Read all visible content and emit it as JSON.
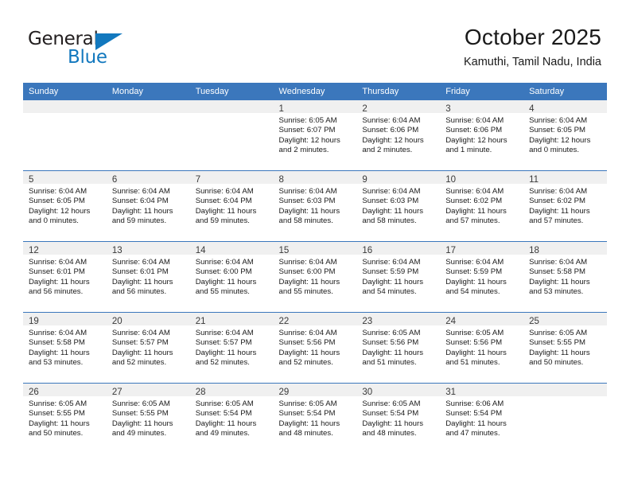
{
  "brand": {
    "name_top": "General",
    "name_bottom": "Blue",
    "accent_color": "#1278be",
    "triangle_icon": "triangle-icon"
  },
  "header": {
    "title": "October 2025",
    "location": "Kamuthi, Tamil Nadu, India"
  },
  "calendar": {
    "header_bg": "#3b77bc",
    "header_text_color": "#ffffff",
    "daynum_bg": "#f0f0f0",
    "weekday_headers": [
      "Sunday",
      "Monday",
      "Tuesday",
      "Wednesday",
      "Thursday",
      "Friday",
      "Saturday"
    ],
    "weeks": [
      [
        {
          "day": "",
          "sunrise": "",
          "sunset": "",
          "daylight1": "",
          "daylight2": ""
        },
        {
          "day": "",
          "sunrise": "",
          "sunset": "",
          "daylight1": "",
          "daylight2": ""
        },
        {
          "day": "",
          "sunrise": "",
          "sunset": "",
          "daylight1": "",
          "daylight2": ""
        },
        {
          "day": "1",
          "sunrise": "Sunrise: 6:05 AM",
          "sunset": "Sunset: 6:07 PM",
          "daylight1": "Daylight: 12 hours",
          "daylight2": "and 2 minutes."
        },
        {
          "day": "2",
          "sunrise": "Sunrise: 6:04 AM",
          "sunset": "Sunset: 6:06 PM",
          "daylight1": "Daylight: 12 hours",
          "daylight2": "and 2 minutes."
        },
        {
          "day": "3",
          "sunrise": "Sunrise: 6:04 AM",
          "sunset": "Sunset: 6:06 PM",
          "daylight1": "Daylight: 12 hours",
          "daylight2": "and 1 minute."
        },
        {
          "day": "4",
          "sunrise": "Sunrise: 6:04 AM",
          "sunset": "Sunset: 6:05 PM",
          "daylight1": "Daylight: 12 hours",
          "daylight2": "and 0 minutes."
        }
      ],
      [
        {
          "day": "5",
          "sunrise": "Sunrise: 6:04 AM",
          "sunset": "Sunset: 6:05 PM",
          "daylight1": "Daylight: 12 hours",
          "daylight2": "and 0 minutes."
        },
        {
          "day": "6",
          "sunrise": "Sunrise: 6:04 AM",
          "sunset": "Sunset: 6:04 PM",
          "daylight1": "Daylight: 11 hours",
          "daylight2": "and 59 minutes."
        },
        {
          "day": "7",
          "sunrise": "Sunrise: 6:04 AM",
          "sunset": "Sunset: 6:04 PM",
          "daylight1": "Daylight: 11 hours",
          "daylight2": "and 59 minutes."
        },
        {
          "day": "8",
          "sunrise": "Sunrise: 6:04 AM",
          "sunset": "Sunset: 6:03 PM",
          "daylight1": "Daylight: 11 hours",
          "daylight2": "and 58 minutes."
        },
        {
          "day": "9",
          "sunrise": "Sunrise: 6:04 AM",
          "sunset": "Sunset: 6:03 PM",
          "daylight1": "Daylight: 11 hours",
          "daylight2": "and 58 minutes."
        },
        {
          "day": "10",
          "sunrise": "Sunrise: 6:04 AM",
          "sunset": "Sunset: 6:02 PM",
          "daylight1": "Daylight: 11 hours",
          "daylight2": "and 57 minutes."
        },
        {
          "day": "11",
          "sunrise": "Sunrise: 6:04 AM",
          "sunset": "Sunset: 6:02 PM",
          "daylight1": "Daylight: 11 hours",
          "daylight2": "and 57 minutes."
        }
      ],
      [
        {
          "day": "12",
          "sunrise": "Sunrise: 6:04 AM",
          "sunset": "Sunset: 6:01 PM",
          "daylight1": "Daylight: 11 hours",
          "daylight2": "and 56 minutes."
        },
        {
          "day": "13",
          "sunrise": "Sunrise: 6:04 AM",
          "sunset": "Sunset: 6:01 PM",
          "daylight1": "Daylight: 11 hours",
          "daylight2": "and 56 minutes."
        },
        {
          "day": "14",
          "sunrise": "Sunrise: 6:04 AM",
          "sunset": "Sunset: 6:00 PM",
          "daylight1": "Daylight: 11 hours",
          "daylight2": "and 55 minutes."
        },
        {
          "day": "15",
          "sunrise": "Sunrise: 6:04 AM",
          "sunset": "Sunset: 6:00 PM",
          "daylight1": "Daylight: 11 hours",
          "daylight2": "and 55 minutes."
        },
        {
          "day": "16",
          "sunrise": "Sunrise: 6:04 AM",
          "sunset": "Sunset: 5:59 PM",
          "daylight1": "Daylight: 11 hours",
          "daylight2": "and 54 minutes."
        },
        {
          "day": "17",
          "sunrise": "Sunrise: 6:04 AM",
          "sunset": "Sunset: 5:59 PM",
          "daylight1": "Daylight: 11 hours",
          "daylight2": "and 54 minutes."
        },
        {
          "day": "18",
          "sunrise": "Sunrise: 6:04 AM",
          "sunset": "Sunset: 5:58 PM",
          "daylight1": "Daylight: 11 hours",
          "daylight2": "and 53 minutes."
        }
      ],
      [
        {
          "day": "19",
          "sunrise": "Sunrise: 6:04 AM",
          "sunset": "Sunset: 5:58 PM",
          "daylight1": "Daylight: 11 hours",
          "daylight2": "and 53 minutes."
        },
        {
          "day": "20",
          "sunrise": "Sunrise: 6:04 AM",
          "sunset": "Sunset: 5:57 PM",
          "daylight1": "Daylight: 11 hours",
          "daylight2": "and 52 minutes."
        },
        {
          "day": "21",
          "sunrise": "Sunrise: 6:04 AM",
          "sunset": "Sunset: 5:57 PM",
          "daylight1": "Daylight: 11 hours",
          "daylight2": "and 52 minutes."
        },
        {
          "day": "22",
          "sunrise": "Sunrise: 6:04 AM",
          "sunset": "Sunset: 5:56 PM",
          "daylight1": "Daylight: 11 hours",
          "daylight2": "and 52 minutes."
        },
        {
          "day": "23",
          "sunrise": "Sunrise: 6:05 AM",
          "sunset": "Sunset: 5:56 PM",
          "daylight1": "Daylight: 11 hours",
          "daylight2": "and 51 minutes."
        },
        {
          "day": "24",
          "sunrise": "Sunrise: 6:05 AM",
          "sunset": "Sunset: 5:56 PM",
          "daylight1": "Daylight: 11 hours",
          "daylight2": "and 51 minutes."
        },
        {
          "day": "25",
          "sunrise": "Sunrise: 6:05 AM",
          "sunset": "Sunset: 5:55 PM",
          "daylight1": "Daylight: 11 hours",
          "daylight2": "and 50 minutes."
        }
      ],
      [
        {
          "day": "26",
          "sunrise": "Sunrise: 6:05 AM",
          "sunset": "Sunset: 5:55 PM",
          "daylight1": "Daylight: 11 hours",
          "daylight2": "and 50 minutes."
        },
        {
          "day": "27",
          "sunrise": "Sunrise: 6:05 AM",
          "sunset": "Sunset: 5:55 PM",
          "daylight1": "Daylight: 11 hours",
          "daylight2": "and 49 minutes."
        },
        {
          "day": "28",
          "sunrise": "Sunrise: 6:05 AM",
          "sunset": "Sunset: 5:54 PM",
          "daylight1": "Daylight: 11 hours",
          "daylight2": "and 49 minutes."
        },
        {
          "day": "29",
          "sunrise": "Sunrise: 6:05 AM",
          "sunset": "Sunset: 5:54 PM",
          "daylight1": "Daylight: 11 hours",
          "daylight2": "and 48 minutes."
        },
        {
          "day": "30",
          "sunrise": "Sunrise: 6:05 AM",
          "sunset": "Sunset: 5:54 PM",
          "daylight1": "Daylight: 11 hours",
          "daylight2": "and 48 minutes."
        },
        {
          "day": "31",
          "sunrise": "Sunrise: 6:06 AM",
          "sunset": "Sunset: 5:54 PM",
          "daylight1": "Daylight: 11 hours",
          "daylight2": "and 47 minutes."
        },
        {
          "day": "",
          "sunrise": "",
          "sunset": "",
          "daylight1": "",
          "daylight2": ""
        }
      ]
    ]
  }
}
